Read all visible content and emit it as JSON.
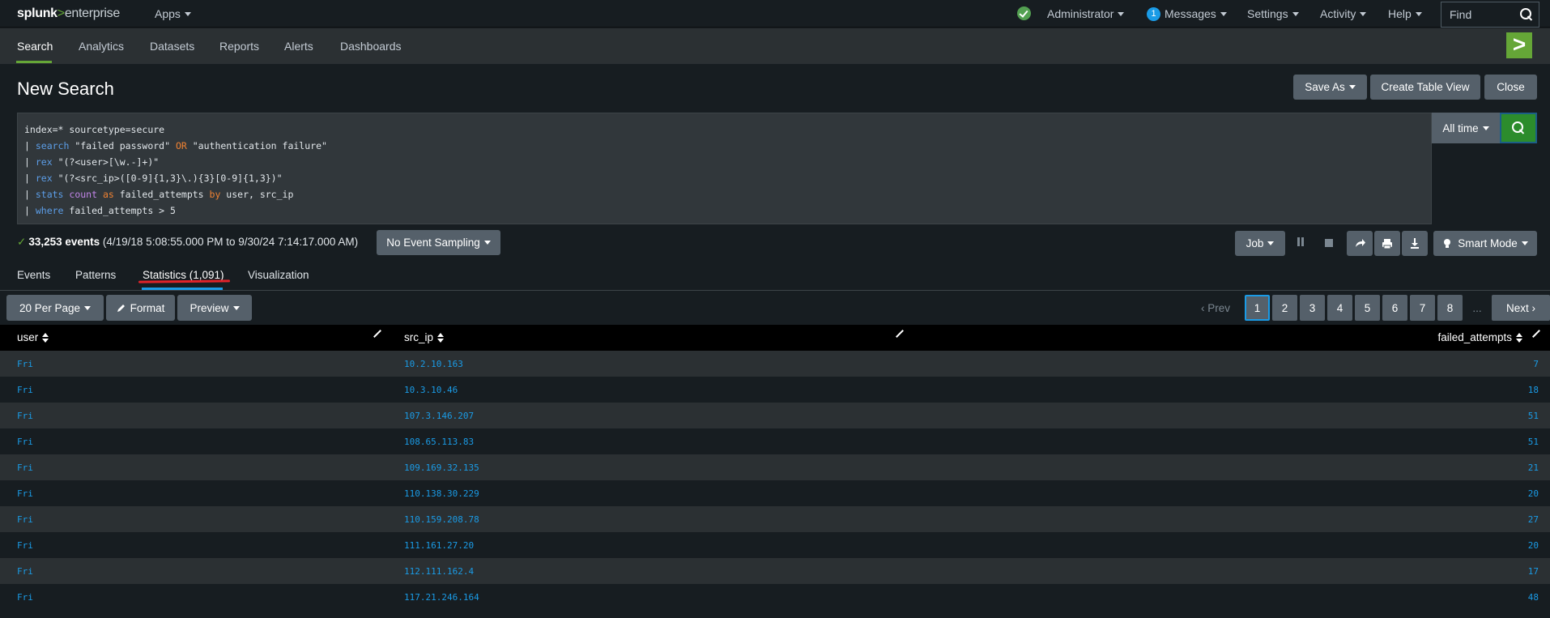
{
  "topbar": {
    "logo_main": "splunk",
    "logo_gt": ">",
    "logo_product": "enterprise",
    "apps_label": "Apps",
    "admin_label": "Administrator",
    "messages_count": "1",
    "messages_label": "Messages",
    "settings_label": "Settings",
    "activity_label": "Activity",
    "help_label": "Help",
    "find_placeholder": "Find"
  },
  "appnav": {
    "items": [
      "Search",
      "Analytics",
      "Datasets",
      "Reports",
      "Alerts",
      "Dashboards"
    ],
    "app_icon_glyph": ">"
  },
  "page": {
    "title": "New Search",
    "save_as_label": "Save As",
    "create_table_label": "Create Table View",
    "close_label": "Close"
  },
  "query": {
    "line1": "index=* sourcetype=secure",
    "pipe": "| ",
    "l2_cmd": "search",
    "l2_a": " \"failed password\" ",
    "l2_op": "OR",
    "l2_b": " \"authentication failure\"",
    "l3_cmd": "rex",
    "l3_arg": " \"(?<user>[\\w.-]+)\"",
    "l4_cmd": "rex",
    "l4_arg": " \"(?<src_ip>([0-9]{1,3}\\.){3}[0-9]{1,3})\"",
    "l5_cmd": "stats",
    "l5_fn": " count",
    "l5_as": " as",
    "l5_mid": " failed_attempts ",
    "l5_by": "by",
    "l5_end": " user, src_ip",
    "l6_cmd": "where",
    "l6_arg": " failed_attempts > 5"
  },
  "timerange": {
    "label": "All time"
  },
  "status": {
    "check": "✓",
    "events": "33,253 events",
    "range": " (4/19/18 5:08:55.000 PM to 9/30/24 7:14:17.000 AM)",
    "sampling_label": "No Event Sampling",
    "job_label": "Job",
    "mode_label": "Smart Mode"
  },
  "tabs": [
    "Events",
    "Patterns",
    "Statistics (1,091)",
    "Visualization"
  ],
  "pager": {
    "per_page_label": "20 Per Page",
    "format_label": "Format",
    "preview_label": "Preview",
    "prev_label": "‹ Prev",
    "pages": [
      "1",
      "2",
      "3",
      "4",
      "5",
      "6",
      "7",
      "8"
    ],
    "ellipsis": "...",
    "next_label": "Next ›"
  },
  "table": {
    "columns": [
      "user",
      "src_ip",
      "failed_attempts"
    ],
    "rows": [
      [
        "Fri",
        "10.2.10.163",
        "7"
      ],
      [
        "Fri",
        "10.3.10.46",
        "18"
      ],
      [
        "Fri",
        "107.3.146.207",
        "51"
      ],
      [
        "Fri",
        "108.65.113.83",
        "51"
      ],
      [
        "Fri",
        "109.169.32.135",
        "21"
      ],
      [
        "Fri",
        "110.138.30.229",
        "20"
      ],
      [
        "Fri",
        "110.159.208.78",
        "27"
      ],
      [
        "Fri",
        "111.161.27.20",
        "20"
      ],
      [
        "Fri",
        "112.111.162.4",
        "17"
      ],
      [
        "Fri",
        "117.21.246.164",
        "48"
      ]
    ]
  },
  "colors": {
    "accent_green": "#65a637",
    "link_blue": "#1a9be6",
    "run_button": "#2c8c2c",
    "annotation_red": "#e0232a"
  }
}
